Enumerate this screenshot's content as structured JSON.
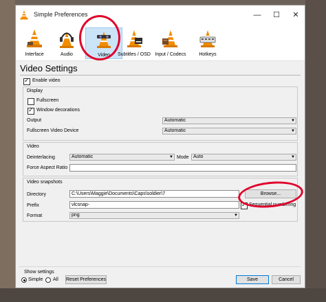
{
  "window": {
    "title": "Simple Preferences",
    "minimize_glyph": "—",
    "maximize_glyph": "☐",
    "close_glyph": "✕"
  },
  "toolbar": {
    "items": [
      {
        "label": "Interface",
        "icon": "vlc-cone-icon"
      },
      {
        "label": "Audio",
        "icon": "headphones-icon"
      },
      {
        "label": "Video",
        "icon": "video-cone-icon",
        "selected": true
      },
      {
        "label": "Subtitles / OSD",
        "icon": "subtitles-cone-icon"
      },
      {
        "label": "Input / Codecs",
        "icon": "input-cone-icon"
      },
      {
        "label": "Hotkeys",
        "icon": "hotkeys-cone-icon"
      }
    ]
  },
  "page": {
    "title": "Video Settings",
    "enable_video_label": "Enable video",
    "enable_video_checked": true
  },
  "display": {
    "title": "Display",
    "fullscreen_label": "Fullscreen",
    "fullscreen_checked": false,
    "decorations_label": "Window decorations",
    "decorations_checked": true,
    "output_label": "Output",
    "output_value": "Automatic",
    "fs_device_label": "Fullscreen Video Device",
    "fs_device_value": "Automatic"
  },
  "video": {
    "title": "Video",
    "deinterlacing_label": "Deinterlacing",
    "deinterlacing_value": "Automatic",
    "mode_label": "Mode",
    "mode_value": "Auto",
    "aspect_label": "Force Aspect Ratio",
    "aspect_value": ""
  },
  "snapshots": {
    "title": "Video snapshots",
    "directory_label": "Directory",
    "directory_value": "C:\\Users\\Maggie\\Documents\\Caps\\soldier\\7",
    "browse_label": "Browse...",
    "prefix_label": "Prefix",
    "prefix_value": "vlcsnap-",
    "sequential_label": "Sequential numbering",
    "sequential_checked": true,
    "format_label": "Format",
    "format_value": "png"
  },
  "footer": {
    "show_settings_label": "Show settings",
    "simple_label": "Simple",
    "all_label": "All",
    "simple_checked": true,
    "reset_label": "Reset Preferences",
    "save_label": "Save",
    "cancel_label": "Cancel"
  },
  "colors": {
    "annotation_red": "#e0002a",
    "selected_tab_bg": "#cce4f7",
    "default_button_border": "#0078d7",
    "vlc_orange": "#f28c00"
  }
}
